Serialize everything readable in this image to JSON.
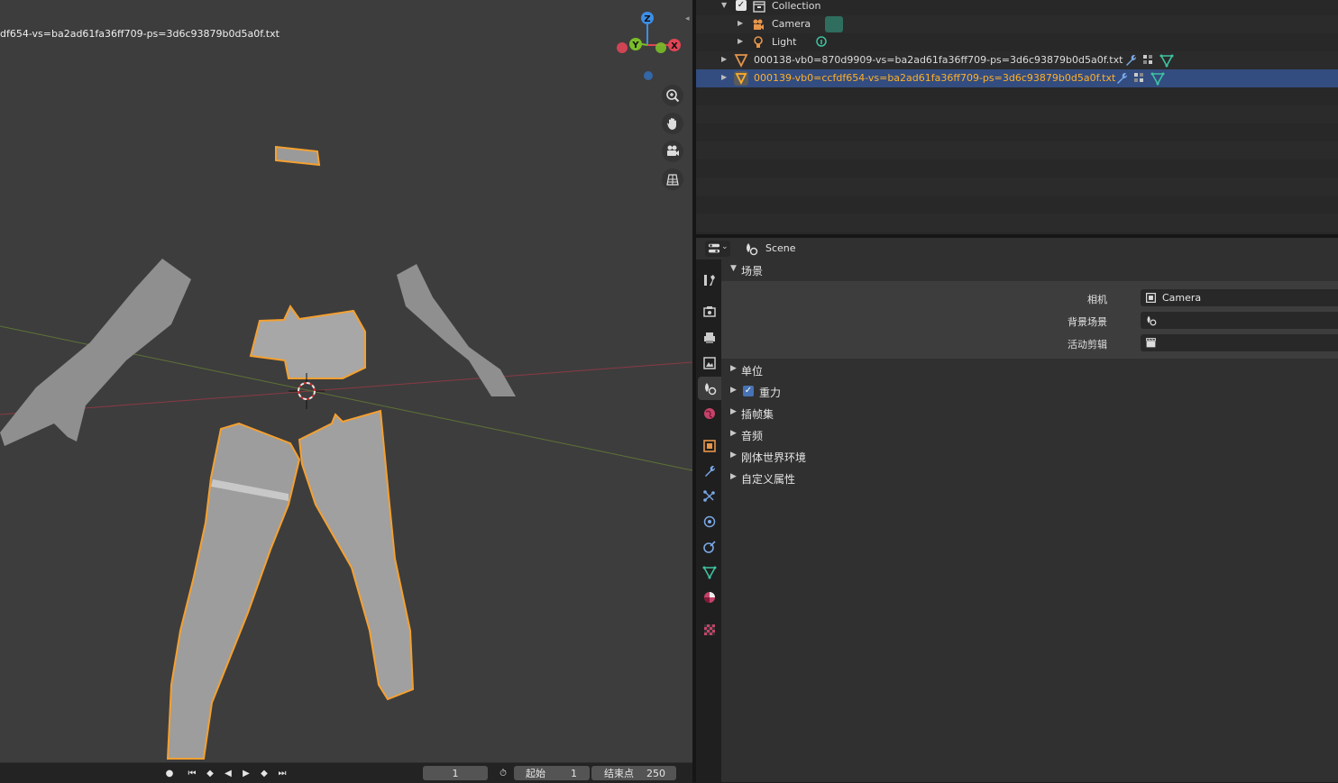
{
  "viewport": {
    "object_title": "df654-vs=ba2ad61fa36ff709-ps=3d6c93879b0d5a0f.txt",
    "gizmo": {
      "z": "Z",
      "y": "Y",
      "x": "X"
    },
    "nav_icons": [
      "zoom-icon",
      "hand-pan-icon",
      "camera-view-icon",
      "grid-ortho-icon"
    ]
  },
  "timeline": {
    "current_frame": "1",
    "start_label": "起始",
    "start_value": "1",
    "end_label": "结束点",
    "end_value": "250"
  },
  "outliner": {
    "rows": [
      {
        "label": "Collection"
      },
      {
        "label": "Camera"
      },
      {
        "label": "Light"
      },
      {
        "label": "000138-vb0=870d9909-vs=ba2ad61fa36ff709-ps=3d6c93879b0d5a0f.txt"
      },
      {
        "label": "000139-vb0=ccfdf654-vs=ba2ad61fa36ff709-ps=3d6c93879b0d5a0f.txt"
      }
    ]
  },
  "properties": {
    "context_label": "Scene",
    "scene_panel": {
      "title": "场景",
      "camera_label": "相机",
      "camera_value": "Camera",
      "background_label": "背景场景",
      "background_value": "",
      "clip_label": "活动剪辑",
      "clip_value": ""
    },
    "panels": [
      {
        "label": "单位"
      },
      {
        "label": "重力",
        "checkbox": true
      },
      {
        "label": "插帧集"
      },
      {
        "label": "音频"
      },
      {
        "label": "刚体世界环境"
      },
      {
        "label": "自定义属性"
      }
    ]
  },
  "colors": {
    "selection_outline": "#f5a030",
    "active_text": "#ffaf29",
    "selected_row": "#334d80",
    "axis_x": "#e04556",
    "axis_y": "#7bbd28",
    "axis_z": "#3d8ee5"
  }
}
